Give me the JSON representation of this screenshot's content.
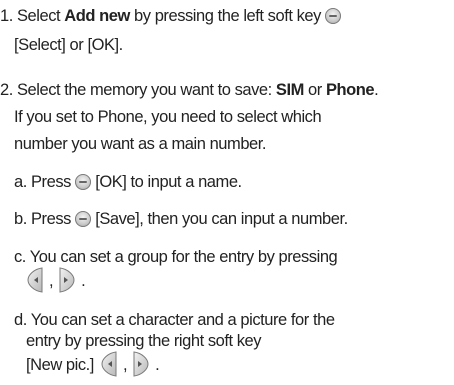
{
  "steps": [
    {
      "lines": [
        [
          "1. Select ",
          "Add new",
          " by pressing the left soft key "
        ],
        [
          "[Select] or [OK]."
        ]
      ]
    },
    {
      "lines": [
        [
          "2. Select the memory you want to save: ",
          "SIM",
          " or ",
          "Phone",
          "."
        ],
        [
          "If you set to Phone, you need to select which"
        ],
        [
          "number you want as a main number."
        ]
      ]
    }
  ],
  "substeps": [
    {
      "lines": [
        [
          "a. Press "
        ],
        [
          "[OK] to input a name."
        ]
      ]
    },
    {
      "lines": [
        [
          "b. Press "
        ],
        [
          "[Save], then you can input a number."
        ]
      ]
    },
    {
      "lines": [
        [
          "c. You can set a group for the entry by pressing"
        ],
        [
          ","
        ],
        [
          "."
        ]
      ]
    },
    {
      "lines": [
        [
          "d. You can set a character and a picture for the"
        ],
        [
          "entry by pressing the right soft key"
        ],
        [
          "[New pic.]"
        ],
        [
          ","
        ],
        [
          "."
        ]
      ]
    }
  ],
  "icons": {
    "soft_key": "soft-key-icon",
    "nav_left": "navigation-left-key-icon",
    "nav_right": "navigation-right-key-icon"
  }
}
